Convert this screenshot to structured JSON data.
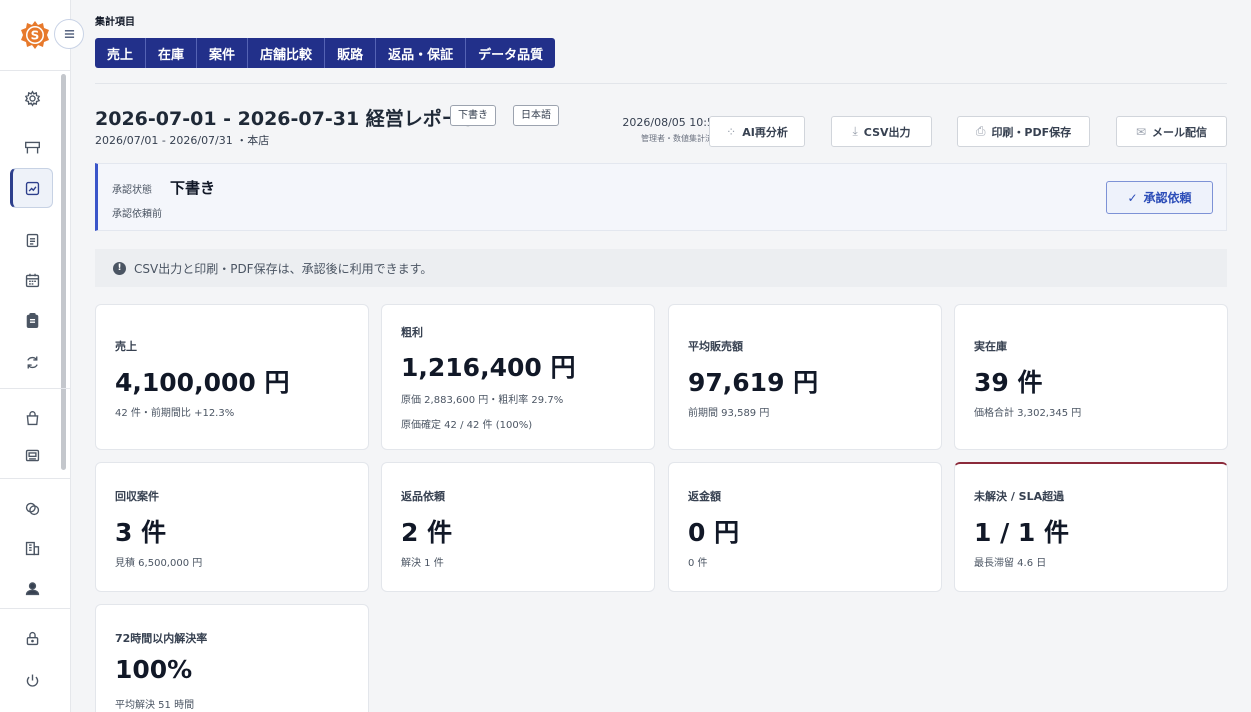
{
  "sidebar": {
    "menu_toggle_icon": "menu-lines-icon",
    "icons": [
      "gear-icon",
      "store-icon",
      "chart-icon",
      "list-icon",
      "calendar-icon",
      "clipboard-icon",
      "refresh-icon",
      "bag-icon",
      "register-icon",
      "coins-icon",
      "building-icon",
      "user-icon",
      "lock-icon",
      "power-icon"
    ]
  },
  "header": {
    "section_label": "集計項目",
    "tabs": [
      "売上",
      "在庫",
      "案件",
      "店舗比較",
      "販路",
      "返品・保証",
      "データ品質"
    ]
  },
  "report": {
    "title": "2026-07-01 - 2026-07-31 経営レポート",
    "badge_draft": "下書き",
    "badge_lang": "日本語",
    "subtitle": "2026/07/01 - 2026/07/31 ・本店",
    "timestamp": "2026/08/05 10:58",
    "timestamp_sub": "管理者・数値集計済み",
    "buttons": {
      "ai": "AI再分析",
      "csv": "CSV出力",
      "print": "印刷・PDF保存",
      "mail": "メール配信"
    }
  },
  "approval": {
    "label": "承認状態",
    "value": "下書き",
    "sub": "承認依頼前",
    "button": "承認依頼",
    "check": "✓"
  },
  "notice": {
    "icon": "!",
    "text": "CSV出力と印刷・PDF保存は、承認後に利用できます。"
  },
  "cards": [
    {
      "label": "売上",
      "value": "4,100,000 円",
      "sub1": "42 件・前期間比 +12.3%",
      "sub2": ""
    },
    {
      "label": "粗利",
      "value": "1,216,400 円",
      "sub1": "原価 2,883,600 円・粗利率 29.7%",
      "sub2": "原価確定 42 / 42 件 (100%)"
    },
    {
      "label": "平均販売額",
      "value": "97,619 円",
      "sub1": "前期間 93,589 円",
      "sub2": ""
    },
    {
      "label": "実在庫",
      "value": "39 件",
      "sub1": "価格合計 3,302,345 円",
      "sub2": ""
    },
    {
      "label": "回収案件",
      "value": "3 件",
      "sub1": "見積 6,500,000 円",
      "sub2": ""
    },
    {
      "label": "返品依頼",
      "value": "2 件",
      "sub1": "解決 1 件",
      "sub2": ""
    },
    {
      "label": "返金額",
      "value": "0 円",
      "sub1": "0 件",
      "sub2": ""
    },
    {
      "label": "未解決 / SLA超過",
      "value": "1 / 1 件",
      "sub1": "最長滞留 4.6 日",
      "sub2": ""
    },
    {
      "label": "72時間以内解決率",
      "value": "100%",
      "sub1": "平均解決 51 時間",
      "sub2": ""
    }
  ],
  "colors": {
    "brand_orange": "#e7792b",
    "tab_navy": "#22308a",
    "accent_blue": "#3a55c9",
    "warn_red": "#8b2a3a"
  }
}
